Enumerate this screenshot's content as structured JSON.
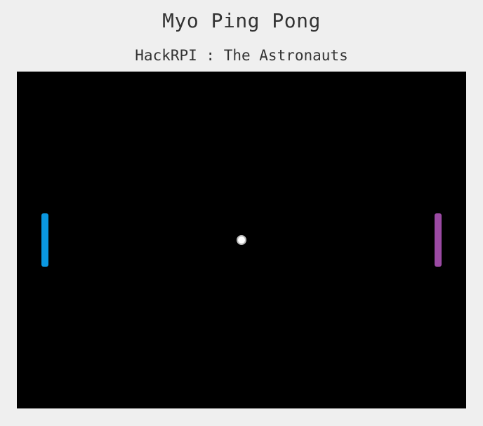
{
  "header": {
    "title": "Myo Ping Pong",
    "subtitle": "HackRPI : The Astronauts"
  },
  "game": {
    "background_color": "#000000",
    "left_paddle": {
      "color": "#0a97e0"
    },
    "right_paddle": {
      "color": "#9b4aa3"
    },
    "ball": {
      "color": "#ffffff"
    }
  }
}
